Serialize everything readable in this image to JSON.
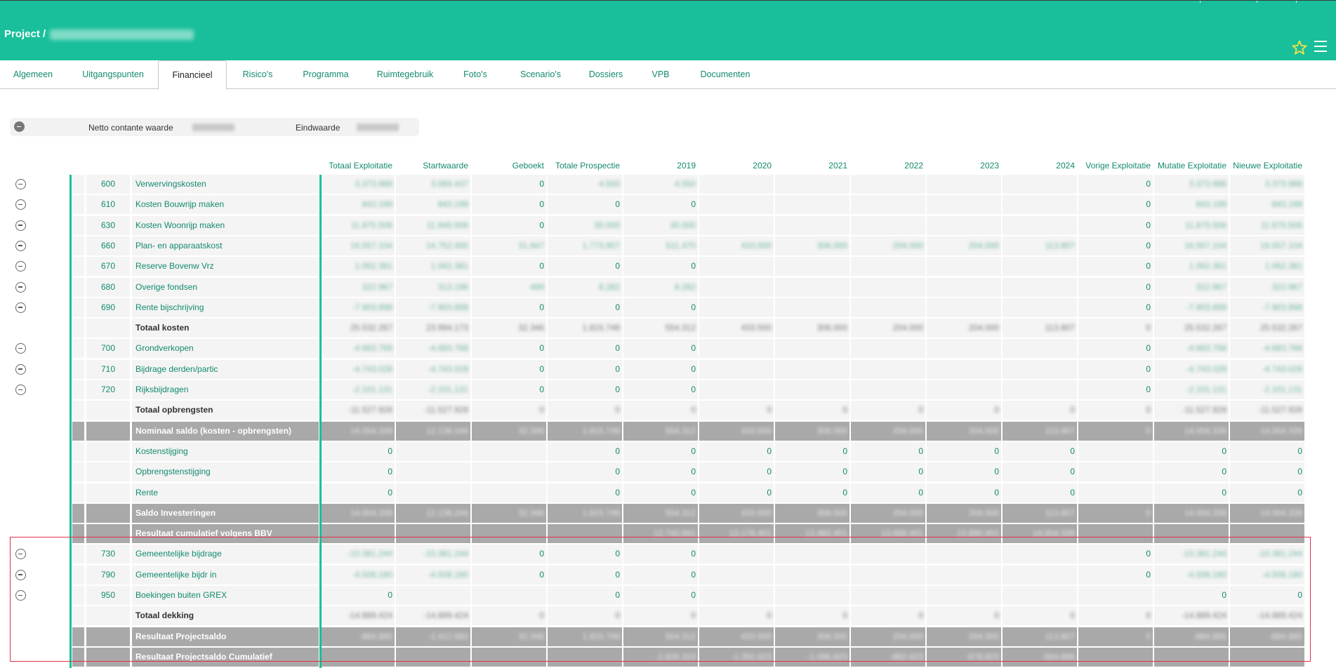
{
  "header": {
    "title_prefix": "Project /",
    "project_name": "400347 Project Naam",
    "star_icon": "star-icon",
    "menu_icon": "hamburger-menu-icon"
  },
  "tabs": [
    "Algemeen",
    "Uitgangspunten",
    "Financieel",
    "Risico's",
    "Programma",
    "Ruimtegebruik",
    "Foto's",
    "Scenario's",
    "Dossiers",
    "VPB",
    "Documenten"
  ],
  "active_tab": "Financieel",
  "summary": {
    "ncw_label": "Netto contante waarde",
    "ncw_value": "10.650.000",
    "eind_label": "Eindwaarde",
    "eind_value": "14.650.000"
  },
  "columns": [
    "Totaal Exploitatie",
    "Startwaarde",
    "Geboekt",
    "Totale Prospectie",
    "2019",
    "2020",
    "2021",
    "2022",
    "2023",
    "2024",
    "Vorige Exploitatie",
    "Mutatie Exploitatie",
    "Nieuwe Exploitatie"
  ],
  "rows": [
    {
      "code": "600",
      "label": "Verwervingskosten",
      "type": "item",
      "toggle": true,
      "values": [
        "3.373.988",
        "3.069.437",
        "0",
        "4.550",
        "4.550",
        "",
        "",
        "",
        "",
        "",
        "0",
        "3.373.988",
        "3.373.988"
      ]
    },
    {
      "code": "610",
      "label": "Kosten Bouwrijp maken",
      "type": "item",
      "toggle": true,
      "values": [
        "843.199",
        "843.199",
        "0",
        "0",
        "0",
        "",
        "",
        "",
        "",
        "",
        "0",
        "843.199",
        "843.199"
      ]
    },
    {
      "code": "630",
      "label": "Kosten Woonrijp maken",
      "type": "item",
      "toggle": true,
      "values": [
        "11.875.506",
        "11.845.506",
        "0",
        "30.000",
        "30.000",
        "",
        "",
        "",
        "",
        "",
        "0",
        "11.875.506",
        "11.875.506"
      ]
    },
    {
      "code": "660",
      "label": "Plan- en apparaatskost",
      "type": "item",
      "toggle": true,
      "values": [
        "16.557.104",
        "14.752.000",
        "31.847",
        "1.773.907",
        "511.470",
        "433.500",
        "306.000",
        "204.000",
        "204.000",
        "113.807",
        "0",
        "16.557.104",
        "16.557.104"
      ]
    },
    {
      "code": "670",
      "label": "Reserve Bovenw Vrz",
      "type": "item",
      "toggle": true,
      "values": [
        "1.062.381",
        "1.062.381",
        "0",
        "0",
        "0",
        "",
        "",
        "",
        "",
        "",
        "0",
        "1.062.381",
        "1.062.381"
      ]
    },
    {
      "code": "680",
      "label": "Overige fondsen",
      "type": "item",
      "toggle": true,
      "values": [
        "322.967",
        "313.196",
        "499",
        "8.282",
        "8.282",
        "",
        "",
        "",
        "",
        "",
        "0",
        "322.967",
        "322.967"
      ]
    },
    {
      "code": "690",
      "label": "Rente bijschrijving",
      "type": "item",
      "toggle": true,
      "values": [
        "-7.903.898",
        "-7.903.898",
        "0",
        "0",
        "0",
        "",
        "",
        "",
        "",
        "",
        "0",
        "-7.903.898",
        "-7.903.898"
      ]
    },
    {
      "code": "",
      "label": "Totaal kosten",
      "type": "bold",
      "toggle": false,
      "values": [
        "25.532.267",
        "23.994.173",
        "32.346",
        "1.815.749",
        "554.312",
        "433.500",
        "306.000",
        "204.000",
        "204.000",
        "113.807",
        "0",
        "25.532.267",
        "25.532.267"
      ]
    },
    {
      "code": "700",
      "label": "Grondverkopen",
      "type": "item",
      "toggle": true,
      "values": [
        "-4.683.768",
        "-4.683.768",
        "0",
        "0",
        "0",
        "",
        "",
        "",
        "",
        "",
        "0",
        "-4.683.768",
        "-4.683.768"
      ]
    },
    {
      "code": "710",
      "label": "Bijdrage derden/partic",
      "type": "item",
      "toggle": true,
      "values": [
        "-4.743.028",
        "-4.743.028",
        "0",
        "0",
        "0",
        "",
        "",
        "",
        "",
        "",
        "0",
        "-4.743.028",
        "-4.743.028"
      ]
    },
    {
      "code": "720",
      "label": "Rijksbijdragen",
      "type": "item",
      "toggle": true,
      "values": [
        "-2.101.131",
        "-2.101.131",
        "0",
        "0",
        "0",
        "",
        "",
        "",
        "",
        "",
        "0",
        "-2.101.131",
        "-2.101.131"
      ]
    },
    {
      "code": "",
      "label": "Totaal opbrengsten",
      "type": "bold",
      "toggle": false,
      "values": [
        "-11.527.928",
        "-11.527.928",
        "0",
        "0",
        "0",
        "0",
        "0",
        "0",
        "0",
        "0",
        "0",
        "-11.527.928",
        "-11.527.928"
      ]
    },
    {
      "code": "",
      "label": "Nominaal saldo (kosten - opbrengsten)",
      "type": "gray",
      "toggle": false,
      "values": [
        "14.004.339",
        "12.138.244",
        "32.346",
        "1.815.749",
        "554.312",
        "433.500",
        "306.000",
        "204.000",
        "204.000",
        "113.807",
        "0",
        "14.004.339",
        "14.004.339"
      ]
    },
    {
      "code": "",
      "label": "Kostenstijging",
      "type": "item",
      "toggle": false,
      "values": [
        "0",
        "",
        "",
        "0",
        "0",
        "0",
        "0",
        "0",
        "0",
        "0",
        "",
        "0",
        "0"
      ]
    },
    {
      "code": "",
      "label": "Opbrengstenstijging",
      "type": "item",
      "toggle": false,
      "values": [
        "0",
        "",
        "",
        "0",
        "0",
        "0",
        "0",
        "0",
        "0",
        "0",
        "",
        "0",
        "0"
      ]
    },
    {
      "code": "",
      "label": "Rente",
      "type": "item",
      "toggle": false,
      "values": [
        "0",
        "",
        "",
        "0",
        "0",
        "0",
        "0",
        "0",
        "0",
        "0",
        "",
        "0",
        "0"
      ]
    },
    {
      "code": "",
      "label": "Saldo Investeringen",
      "type": "gray",
      "toggle": false,
      "values": [
        "14.004.339",
        "12.138.244",
        "32.346",
        "1.815.749",
        "554.312",
        "433.500",
        "306.000",
        "204.000",
        "204.000",
        "113.807",
        "0",
        "14.004.339",
        "14.004.339"
      ]
    },
    {
      "code": "",
      "label": "Resultaat cumulatief volgens BBV",
      "type": "gray",
      "toggle": false,
      "values": [
        "",
        "",
        "",
        "",
        "12.742.661",
        "13.176.401",
        "13.482.401",
        "13.686.401",
        "13.890.401",
        "14.004.339",
        "",
        "",
        ""
      ]
    },
    {
      "code": "730",
      "label": "Gemeentelijke bijdrage",
      "type": "item",
      "toggle": true,
      "values": [
        "-10.381.244",
        "-10.381.244",
        "0",
        "0",
        "0",
        "",
        "",
        "",
        "",
        "",
        "0",
        "-10.381.244",
        "-10.381.244"
      ]
    },
    {
      "code": "790",
      "label": "Gemeentelijke bijdr in",
      "type": "item",
      "toggle": true,
      "values": [
        "-4.508.180",
        "-4.508.180",
        "0",
        "0",
        "0",
        "",
        "",
        "",
        "",
        "",
        "0",
        "-4.508.180",
        "-4.508.180"
      ]
    },
    {
      "code": "950",
      "label": "Boekingen buiten GREX",
      "type": "item",
      "toggle": true,
      "values": [
        "0",
        "",
        "",
        "0",
        "0",
        "",
        "",
        "",
        "",
        "",
        "",
        "0",
        "0"
      ]
    },
    {
      "code": "",
      "label": "Totaal dekking",
      "type": "bold",
      "toggle": false,
      "values": [
        "-14.889.424",
        "-14.889.424",
        "0",
        "0",
        "0",
        "0",
        "0",
        "0",
        "0",
        "0",
        "0",
        "-14.889.424",
        "-14.889.424"
      ]
    },
    {
      "code": "",
      "label": "Resultaat Projectsaldo",
      "type": "gray",
      "toggle": false,
      "values": [
        "-884.885",
        "-2.412.660",
        "32.346",
        "1.815.749",
        "554.312",
        "433.500",
        "306.000",
        "204.000",
        "204.000",
        "113.807",
        "0",
        "-884.885",
        "-884.885"
      ]
    },
    {
      "code": "",
      "label": "Resultaat Projectsaldo Cumulatief",
      "type": "gray",
      "toggle": false,
      "values": [
        "",
        "",
        "",
        "",
        "-1.826.323",
        "-1.392.823",
        "-1.086.823",
        "-882.823",
        "-678.823",
        "-564.886",
        "",
        "",
        ""
      ]
    }
  ],
  "clear_value_strings": [
    "0"
  ]
}
